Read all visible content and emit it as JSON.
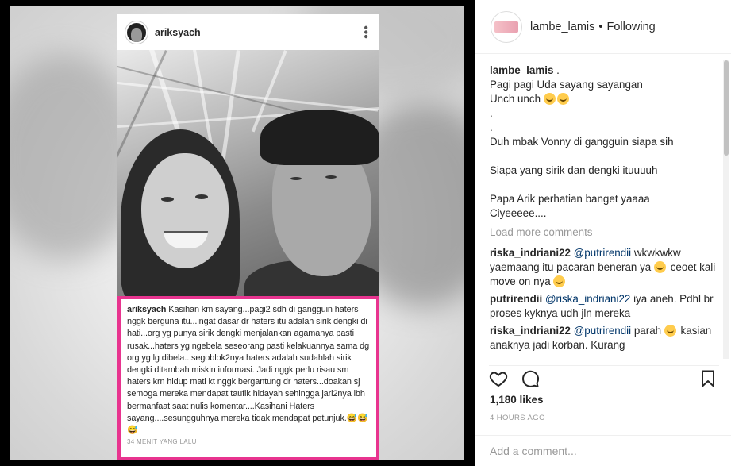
{
  "embedded_post": {
    "username": "ariksyach",
    "caption_user": "ariksyach",
    "caption": " Kasihan km sayang...pagi2 sdh di gangguin haters nggk berguna itu...ingat dasar dr haters itu adalah sirik dengki di hati...org yg punya sirik dengki menjalankan agamanya pasti rusak...haters yg ngebela seseorang pasti kelakuannya sama dg org yg lg dibela...segoblok2nya haters adalah sudahlah sirik dengki ditambah miskin informasi. Jadi nggk perlu risau sm haters krn hidup mati kt nggk bergantung dr haters...doakan sj semoga mereka mendapat taufik hidayah sehingga jari2nya lbh bermanfaat saat nulis komentar....Kasihani Haters sayang....sesungguhnya mereka tidak mendapat petunjuk.",
    "caption_emoji": "😅😅😅",
    "time": "34 MENIT YANG LALU",
    "border_color": "#e8348f"
  },
  "post": {
    "author": "lambe_lamis",
    "follow_separator": "•",
    "follow_status": "Following",
    "caption_user": "lambe_lamis",
    "caption_lines": [
      " .",
      "Pagi pagi Uda sayang sayangan",
      "Unch unch ",
      ".",
      ".",
      "Duh mbak Vonny di gangguin siapa sih",
      "",
      "Siapa yang sirik dan dengki ituuuuh",
      "",
      "Papa Arik perhatian banget yaaaa",
      "Ciyeeeee...."
    ],
    "load_more": "Load more comments",
    "comments": [
      {
        "user": "riska_indriani22",
        "mention": "@putrirendii",
        "text": " wkwkwkw yaemaang itu pacaran beneran ya ",
        "text2": " ceoet kali move on nya "
      },
      {
        "user": "putrirendii",
        "mention": "@riska_indriani22",
        "text": " iya aneh. Pdhl br proses kyknya udh jln mereka",
        "text2": ""
      },
      {
        "user": "riska_indriani22",
        "mention": "@putrirendii",
        "text": " parah ",
        "text2": " kasian anaknya jadi korban. Kurang"
      }
    ],
    "likes": "1,180 likes",
    "time": "4 HOURS AGO",
    "comment_placeholder": "Add a comment..."
  },
  "icons": {
    "like": "heart-icon",
    "comment": "comment-bubble-icon",
    "save": "bookmark-icon",
    "more": "more-options-icon"
  }
}
